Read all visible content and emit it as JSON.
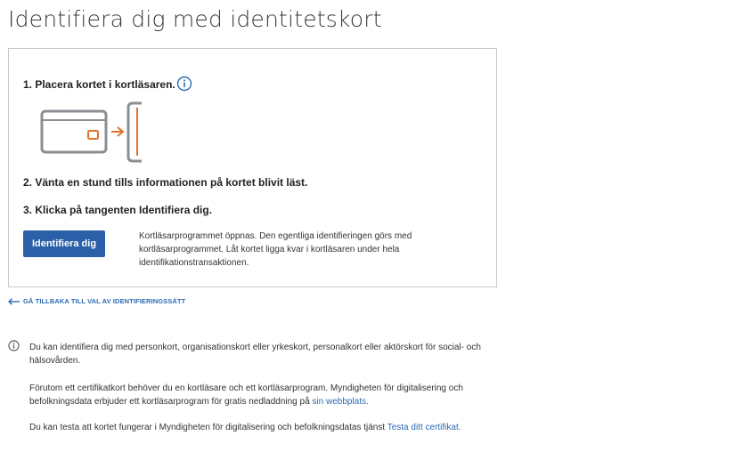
{
  "page": {
    "title": "Identifiera dig med identitetskort"
  },
  "card": {
    "step1": "1. Placera kortet i kortläsaren.",
    "step2": "2. Vänta en stund tills informationen på kortet blivit läst.",
    "step3": "3. Klicka på tangenten Identifiera dig.",
    "identify_button": "Identifiera dig",
    "description": "Kortläsarprogrammet öppnas. Den egentliga identifieringen görs med kortläsarprogrammet. Låt kortet ligga kvar i kortläsaren under hela identifikationstransaktionen."
  },
  "back_link": "GÅ TILLBAKA TILL VAL AV IDENTIFIERINGSSÄTT",
  "info": {
    "p1": "Du kan identifiera dig med personkort, organisationskort eller yrkeskort, personalkort eller aktörskort för social- och hälsovården.",
    "p2_text": "Förutom ett certifikatkort behöver du en kortläsare och ett kortläsarprogram. Myndigheten för digitalisering och befolkningsdata erbjuder ett kortläsarprogram för gratis nedladdning på ",
    "p2_link": "sin webbplats.",
    "p3_text": "Du kan testa att kortet fungerar i Myndigheten för digitalisering och befolkningsdatas tjänst ",
    "p3_link": "Testa ditt certifikat."
  },
  "icons": {
    "info": "info-circle-icon",
    "card_reader": "card-reader-illustration",
    "back": "arrow-left-icon"
  },
  "colors": {
    "primary_button": "#2b5fa8",
    "link": "#2b6bb3",
    "illustration_accent": "#e2722b",
    "illustration_gray": "#8a8f94"
  }
}
